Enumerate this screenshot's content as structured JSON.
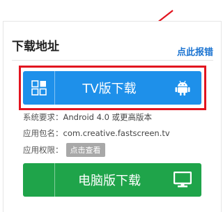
{
  "section": {
    "title": "下载地址",
    "report_link": "点此报错"
  },
  "tv_button": {
    "label": "TV版下载",
    "lead_icon": "grid-icon",
    "tail_icon": "android-icon",
    "color": "#1e90ea"
  },
  "info": {
    "requirement_label": "系统要求：",
    "requirement_value": "Android 4.0 或更高版本",
    "package_label": "应用包名：",
    "package_value": "com.creative.fastscreen.tv",
    "permission_label": "应用权限：",
    "permission_button": "点击查看"
  },
  "pc_button": {
    "label": "电脑版下载",
    "tail_icon": "monitor-icon",
    "color": "#1fa44a"
  },
  "annotation": {
    "highlight_color": "#e2141f"
  }
}
